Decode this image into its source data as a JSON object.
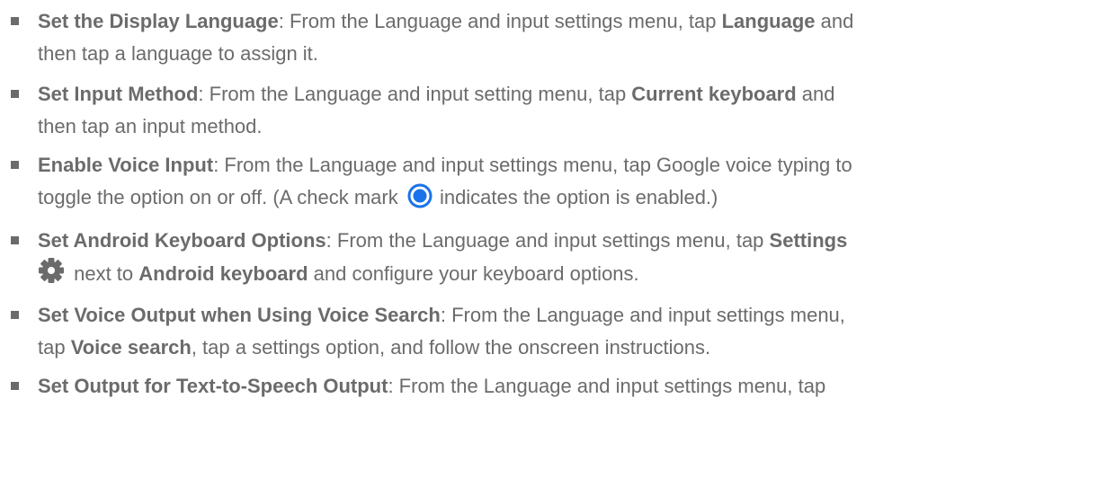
{
  "items": [
    {
      "term": "Set the Display Language",
      "text_a": ": From the Language and input settings menu, tap ",
      "bold_a": "Language",
      "text_b": " and",
      "line2": "then tap a language to assign it."
    },
    {
      "term": "Set Input Method",
      "text_a": ": From the Language and input setting menu, tap ",
      "bold_a": "Current keyboard",
      "text_b": " and",
      "line2": "then tap an input method."
    },
    {
      "term": "Enable Voice Input",
      "text_a": ": From the Language and input settings menu, tap Google voice typing to",
      "line2_a": "toggle the option on or off. (A check mark ",
      "icon": "radio-checked-icon",
      "line2_b": " indicates the option is enabled.)"
    },
    {
      "term": "Set Android Keyboard Options",
      "text_a": ": From the Language and input settings menu, tap ",
      "bold_a": "Settings",
      "icon": "gear-icon",
      "text_b": " next to ",
      "bold_b": "Android keyboard",
      "text_c": " and configure your keyboard options."
    },
    {
      "term": "Set Voice Output when Using Voice Search",
      "text_a": ": From the Language and input settings menu,",
      "line2_a": "tap ",
      "bold_a": "Voice search",
      "line2_b": ", tap a settings option, and follow the onscreen instructions."
    },
    {
      "term": "Set Output for Text-to-Speech Output",
      "text_a": ": From the Language and input settings menu, tap"
    }
  ],
  "colors": {
    "text": "#6b6b6b",
    "accent": "#1a73e8"
  }
}
